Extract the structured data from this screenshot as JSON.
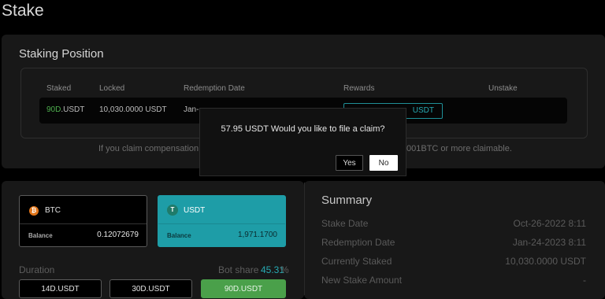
{
  "page": {
    "title": "Stake"
  },
  "staking_position": {
    "title": "Staking Position",
    "headers": {
      "staked": "Staked",
      "locked": "Locked",
      "redemption_date": "Redemption Date",
      "rewards": "Rewards",
      "unstake": "Unstake"
    },
    "row": {
      "staked_duration": "90D",
      "staked_unit": ".USDT",
      "locked": "10,030.0000 USDT",
      "redemption_partial": "Jan-",
      "rewards_partial": "USDT"
    },
    "note_left": "If you claim compensation",
    "note_right": "001BTC or more claimable."
  },
  "assets": {
    "btc": {
      "name": "BTC",
      "icon_glyph": "₿",
      "icon": "bitcoin-icon",
      "balance_label": "Balance",
      "balance": "0.12072679"
    },
    "usdt": {
      "name": "USDT",
      "icon_glyph": "T",
      "icon": "tether-icon",
      "balance_label": "Balance",
      "balance": "1,971.1700"
    }
  },
  "duration": {
    "label": "Duration",
    "bot_share_label": "Bot share",
    "bot_share_value": "45.31",
    "bot_share_unit": "%",
    "options": [
      "14D.USDT",
      "30D.USDT",
      "90D.USDT"
    ],
    "selected": "90D.USDT"
  },
  "summary": {
    "title": "Summary",
    "rows": [
      {
        "label": "Stake Date",
        "value": "Oct-26-2022 8:11"
      },
      {
        "label": "Redemption Date",
        "value": "Jan-24-2023 8:11"
      },
      {
        "label": "Currently Staked",
        "value": "10,030.0000 USDT"
      },
      {
        "label": "New Stake Amount",
        "value": "-"
      }
    ]
  },
  "dialog": {
    "message": "57.95 USDT Would you like to file a claim?",
    "yes_label": "Yes",
    "no_label": "No"
  },
  "colors": {
    "accent_teal": "#1e9da7",
    "accent_green": "#4aa04a",
    "background": "#000000",
    "panel": "#181818"
  }
}
